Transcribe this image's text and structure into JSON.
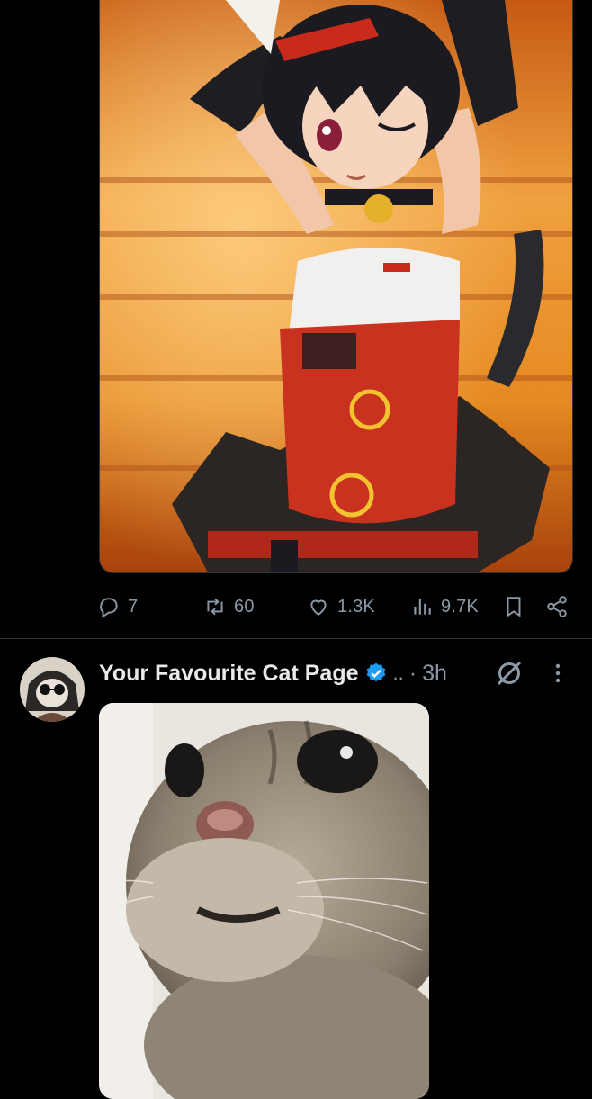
{
  "post1": {
    "image_alt_icon": "anime-character-image",
    "actions": {
      "replies": "7",
      "reposts": "60",
      "likes": "1.3K",
      "views": "9.7K"
    }
  },
  "post2": {
    "author_name": "Your Favourite Cat Page",
    "handle_truncated": "..",
    "separator": "·",
    "time": "3h",
    "image_icon": "cat-photo"
  },
  "colors": {
    "background": "#000000",
    "text": "#e7e9ea",
    "muted": "#8b98a5",
    "verified": "#1d9bf0",
    "divider": "#2f3336"
  }
}
